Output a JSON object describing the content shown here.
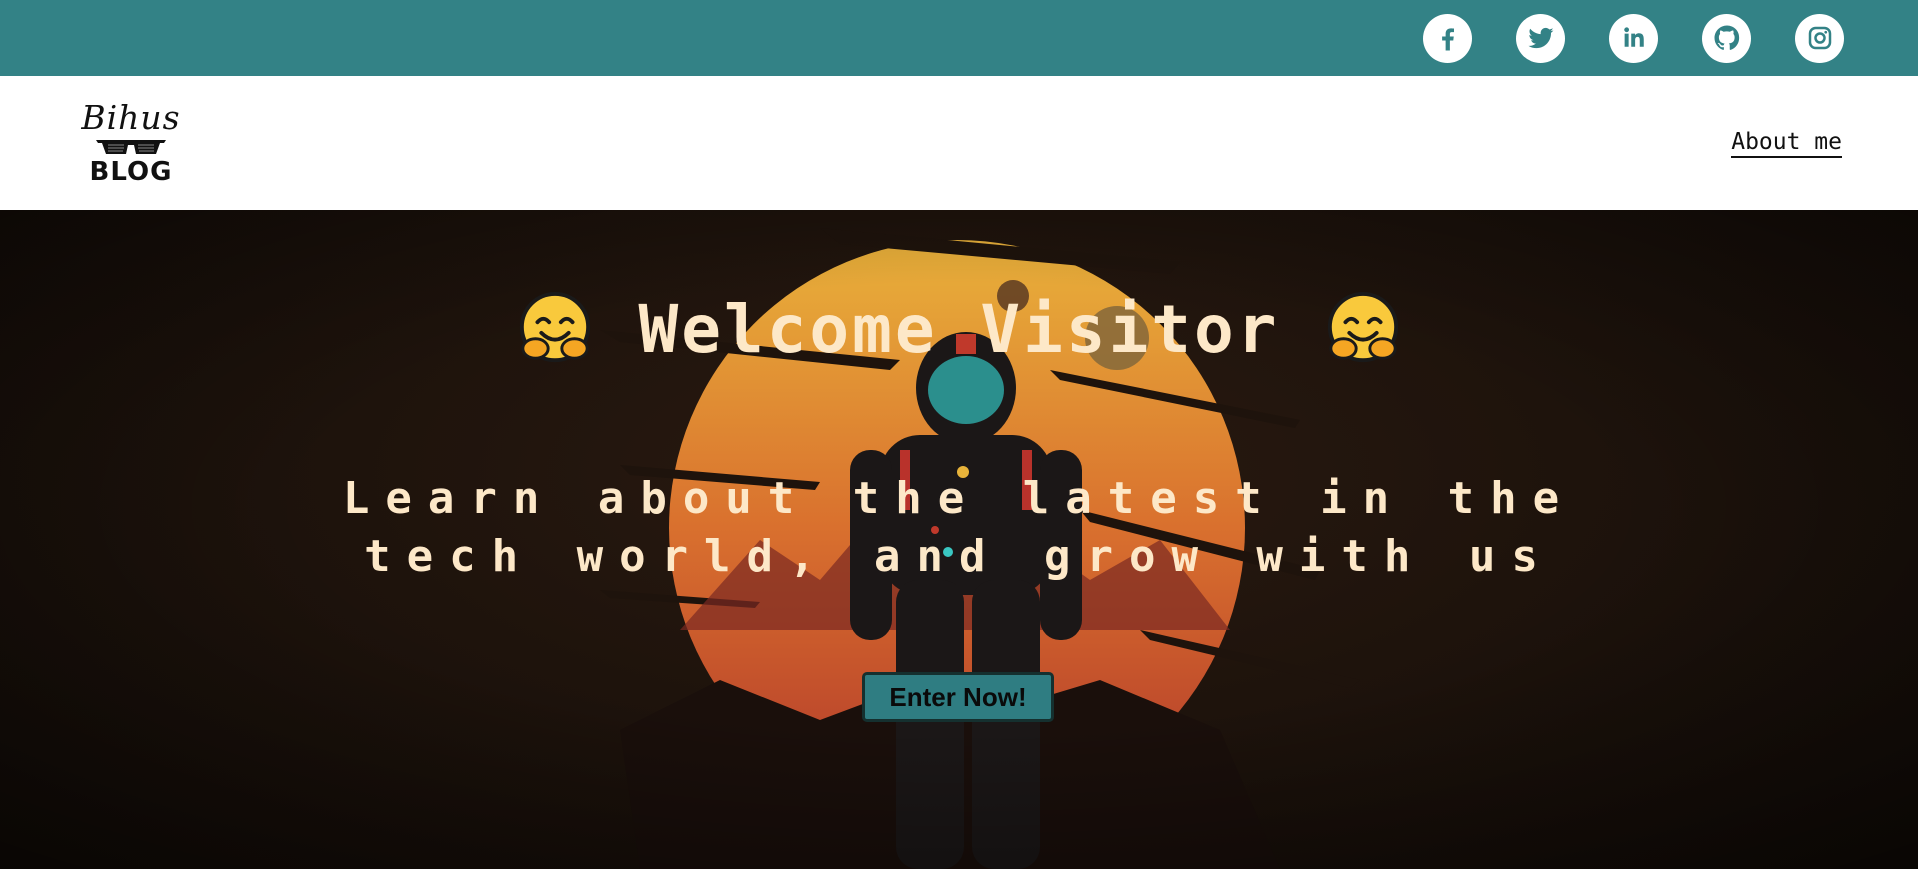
{
  "social": {
    "items": [
      {
        "name": "facebook-icon",
        "label": "Facebook"
      },
      {
        "name": "twitter-icon",
        "label": "Twitter"
      },
      {
        "name": "linkedin-icon",
        "label": "LinkedIn"
      },
      {
        "name": "github-icon",
        "label": "GitHub"
      },
      {
        "name": "instagram-icon",
        "label": "Instagram"
      }
    ],
    "bar_color": "#338286"
  },
  "header": {
    "logo_top": "Bihus",
    "logo_bottom": "BLOG",
    "nav_about": "About me"
  },
  "hero": {
    "title": "Welcome Visitor",
    "title_icon": "hugging-face-emoji",
    "subtitle": "Learn about the latest in the tech world, and grow with us",
    "cta_label": "Enter Now!",
    "text_color": "#fde8c8",
    "accent_color": "#2f7d82"
  }
}
